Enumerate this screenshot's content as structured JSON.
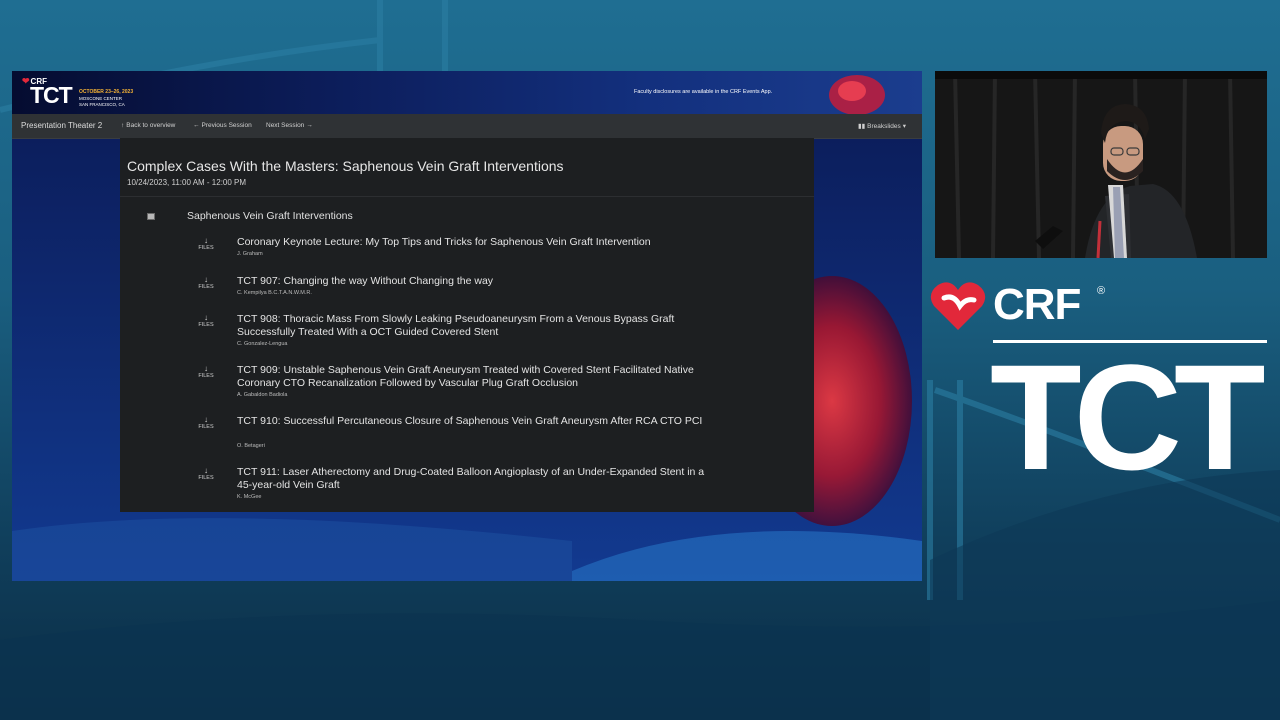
{
  "banner": {
    "brand": {
      "crf": "CRF",
      "tct": "TCT",
      "dates": "OCTOBER 23–26, 2023",
      "venue_line1": "MOSCONE CENTER",
      "venue_line2": "SAN FRANCISCO, CA"
    },
    "notice": "Faculty disclosures are available in the CRF Events App."
  },
  "navbar": {
    "theater": "Presentation Theater 2",
    "back": "Back to overview",
    "previous": "Previous Session",
    "next": "Next Session",
    "breakslides": "Breakslides"
  },
  "icons": {
    "back": "arrow-up-icon",
    "previous": "arrow-left-icon",
    "next": "arrow-right-icon",
    "breakslides": "columns-icon",
    "files": "download-arrow-icon",
    "group": "collapse-square-icon"
  },
  "session": {
    "title": "Complex Cases With the Masters: Saphenous Vein Graft Interventions",
    "time": "10/24/2023, 11:00 AM - 12:00 PM",
    "group_title": "Saphenous Vein Graft Interventions",
    "files_label": "FILES",
    "talks": [
      {
        "title": "Coronary Keynote Lecture: My Top Tips and Tricks for Saphenous Vein Graft Intervention",
        "speaker": "J. Graham"
      },
      {
        "title": "TCT 907: Changing the way Without Changing the way",
        "speaker": "C. Kempilya B.C.T.A.N.W.M.R."
      },
      {
        "title": "TCT 908: Thoracic Mass From Slowly Leaking Pseudoaneurysm From a Venous Bypass Graft Successfully Treated With a OCT Guided Covered Stent",
        "speaker": "C. Gonzalez-Lengua"
      },
      {
        "title": "TCT 909: Unstable Saphenous Vein Graft Aneurysm Treated with Covered Stent Facilitated Native Coronary CTO Recanalization Followed by Vascular Plug Graft Occlusion",
        "speaker": "A. Gabaldon Badiola"
      },
      {
        "title": "TCT 910: Successful Percutaneous Closure of Saphenous Vein Graft Aneurysm After RCA CTO PCI",
        "speaker": "O. Betageri"
      },
      {
        "title": "TCT 911: Laser Atherectomy and Drug-Coated Balloon Angioplasty of an Under-Expanded Stent in a 45-year-old Vein Graft",
        "speaker": "K. McGee"
      }
    ]
  },
  "logo": {
    "crf": "CRF",
    "registered": "®",
    "tct": "TCT"
  },
  "colors": {
    "brand_red": "#e2283a",
    "accent_gold": "#f5b335",
    "panel_bg": "#1d1f21",
    "navbar_bg": "#2f3235"
  }
}
